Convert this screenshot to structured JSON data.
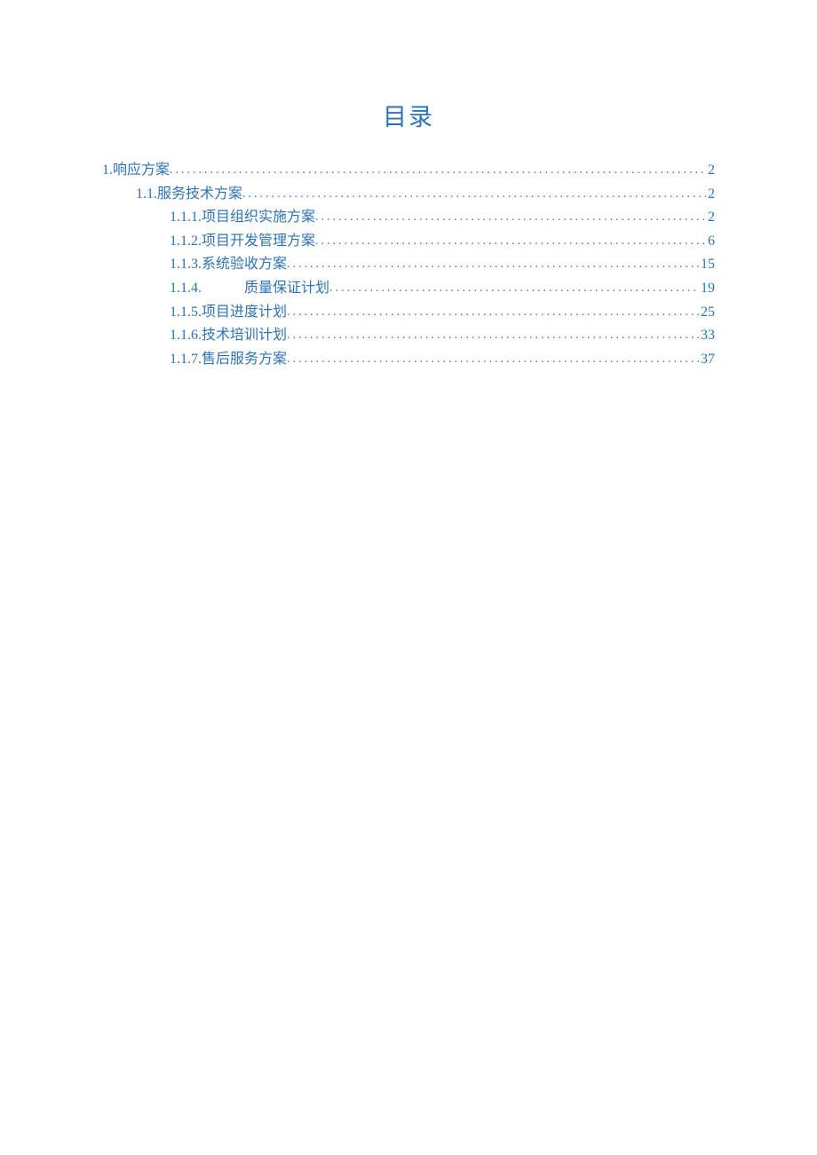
{
  "title": "目录",
  "toc": [
    {
      "level": 1,
      "number": "1.",
      "text": "响应方案",
      "gap": " ",
      "page": "2"
    },
    {
      "level": 2,
      "number": "1.1.",
      "text": "服务技术方案",
      "gap": " ",
      "page": "2"
    },
    {
      "level": 3,
      "number": "1.1.1.",
      "text": "项目组织实施方案",
      "gap": " ",
      "page": "2"
    },
    {
      "level": 3,
      "number": "1.1.2.",
      "text": "项目开发管理方案",
      "gap": " ",
      "page": "6"
    },
    {
      "level": 3,
      "number": "1.1.3.",
      "text": "系统验收方案",
      "gap": " ",
      "page": "15"
    },
    {
      "level": 3,
      "number": "1.1.4.",
      "text": "质量保证计划",
      "gap": "　　　",
      "page": "19"
    },
    {
      "level": 3,
      "number": "1.1.5.",
      "text": "项目进度计划",
      "gap": " ",
      "page": "25"
    },
    {
      "level": 3,
      "number": "1.1.6.",
      "text": "技术培训计划",
      "gap": " ",
      "page": "33"
    },
    {
      "level": 3,
      "number": "1.1.7.",
      "text": "售后服务方案",
      "gap": " ",
      "page": "37"
    }
  ]
}
